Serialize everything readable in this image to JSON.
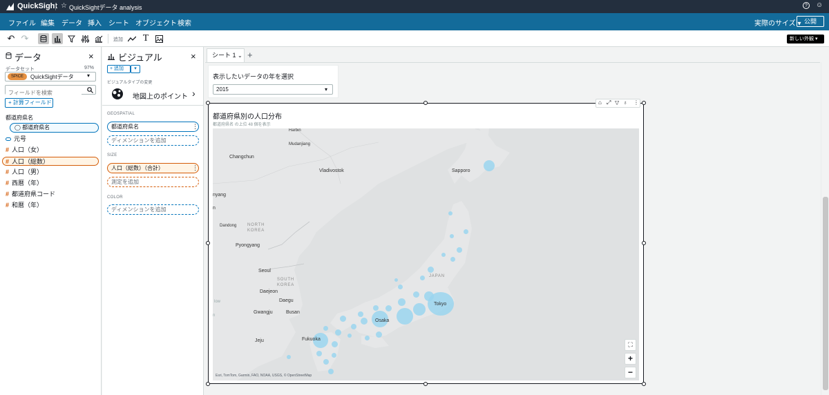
{
  "app": {
    "logo_text": "QuickSight",
    "analysis_title": "QuickSightデータ analysis"
  },
  "menu": [
    "ファイル",
    "編集",
    "データ",
    "挿入",
    "シート",
    "オブジェクト",
    "検索"
  ],
  "header_right": {
    "size_label": "実際のサイズ",
    "publish_label": "公開"
  },
  "toolbar": {
    "add_label": "追加",
    "appearance_label": "新しい外観"
  },
  "data_panel": {
    "title": "データ",
    "dataset_label": "データセット",
    "dataset_percent": "97%",
    "spice_badge": "SPICE",
    "dataset_name": "QuickSightデータ",
    "search_placeholder": "フィールドを検索",
    "calc_field": "計算フィールド",
    "hierarchy_title": "都道府県名",
    "hierarchy_child": "都道府県名",
    "fields": [
      {
        "icon": "dim",
        "name": "元号"
      },
      {
        "icon": "num",
        "name": "人口（女）"
      },
      {
        "icon": "num",
        "name": "人口（総数）"
      },
      {
        "icon": "num",
        "name": "人口（男）"
      },
      {
        "icon": "num",
        "name": "西暦（年）"
      },
      {
        "icon": "num",
        "name": "都道府県コード"
      },
      {
        "icon": "num",
        "name": "和暦（年）"
      }
    ]
  },
  "visual_panel": {
    "title": "ビジュアル",
    "add_label": "追加",
    "change_type": "ビジュアルタイプの変更",
    "visual_type": "地図上のポイント",
    "geo_label": "GEOSPATIAL",
    "geo_field": "都道府県名",
    "geo_add": "ディメンションを追加",
    "size_label": "SIZE",
    "size_field": "人口（総数）（合計）",
    "size_add": "測定を追加",
    "color_label": "COLOR",
    "color_add": "ディメンションを追加"
  },
  "sheet": {
    "tab_label": "シート 1"
  },
  "filter_control": {
    "title": "表示したいデータの年を選択",
    "value": "2015"
  },
  "map_visual": {
    "title": "都道府県別の人口分布",
    "subtitle": "都道府県名 の上位 48 個を表示",
    "attribution": "Esri, TomTom, Garmin, FAO, NOAA, USGS, © OpenStreetMap",
    "labels": {
      "sapporo": "Sapporo",
      "vladivostok": "Vladivostok",
      "mudanjiang": "Mudanjiang",
      "changchun": "Changchun",
      "harbin": "Harbin",
      "pyongyang": "Pyongyang",
      "dandong": "Dandong",
      "north_korea": "NORTH KOREA",
      "south_korea": "SOUTH KOREA",
      "seoul": "Seoul",
      "daejeon": "Daejeon",
      "daegu": "Daegu",
      "gwangju": "Gwangju",
      "busan": "Busan",
      "jeju": "Jeju",
      "fukuoka": "Fukuoka",
      "osaka": "Osaka",
      "tokyo": "Tokyo",
      "japan": "JAPAN",
      "nyang": "nyang",
      "n": "n",
      "low": "low",
      "n2": "n"
    }
  }
}
